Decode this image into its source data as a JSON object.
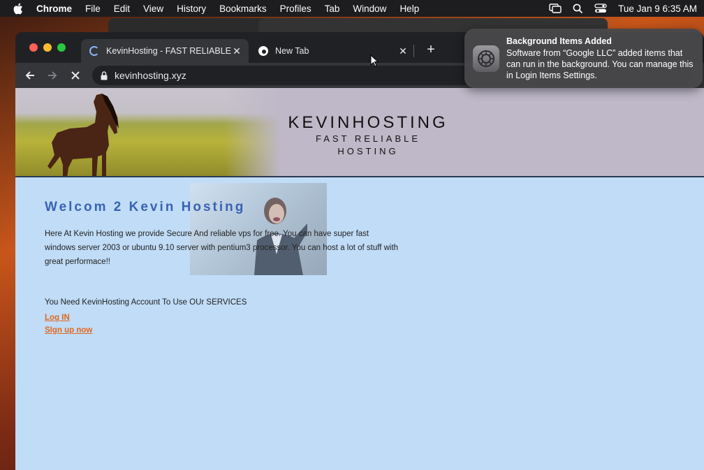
{
  "menubar": {
    "app_name": "Chrome",
    "menus": [
      "File",
      "Edit",
      "View",
      "History",
      "Bookmarks",
      "Profiles",
      "Tab",
      "Window",
      "Help"
    ],
    "clock": "Tue Jan 9  6:35 AM",
    "icons": [
      "apple-icon",
      "screen-mirroring-icon",
      "spotlight-search-icon",
      "control-center-icon"
    ]
  },
  "browser": {
    "tabs": [
      {
        "title": "KevinHosting - FAST RELIABLE",
        "state": "loading",
        "active": true
      },
      {
        "title": "New Tab",
        "state": "idle",
        "active": false
      }
    ],
    "url": "kevinhosting.xyz"
  },
  "page": {
    "brand_name": "KEVINHOSTING",
    "tagline_line1": "FAST RELIABLE",
    "tagline_line2": "HOSTING",
    "welcome": "Welcom 2 Kevin Hosting",
    "description": "Here At Kevin Hosting we provide Secure And reliable vps for free. You can have super fast windows server 2003 or ubuntu 9.10 server with pentium3 processor. You can host a lot of stuff with great performace!!",
    "account_notice": "You Need KevinHosting Account To Use OUr SERVICES",
    "login_link": "Log IN",
    "signup_link": "SIgn up now",
    "colors": {
      "background": "#c0dcf7",
      "heading": "#3a62b3",
      "link": "#e2671e"
    }
  },
  "notification": {
    "title": "Background Items Added",
    "body": "Software from “Google LLC” added items that can run in the background. You can manage this in Login Items Settings.",
    "icon": "system-settings-icon"
  }
}
